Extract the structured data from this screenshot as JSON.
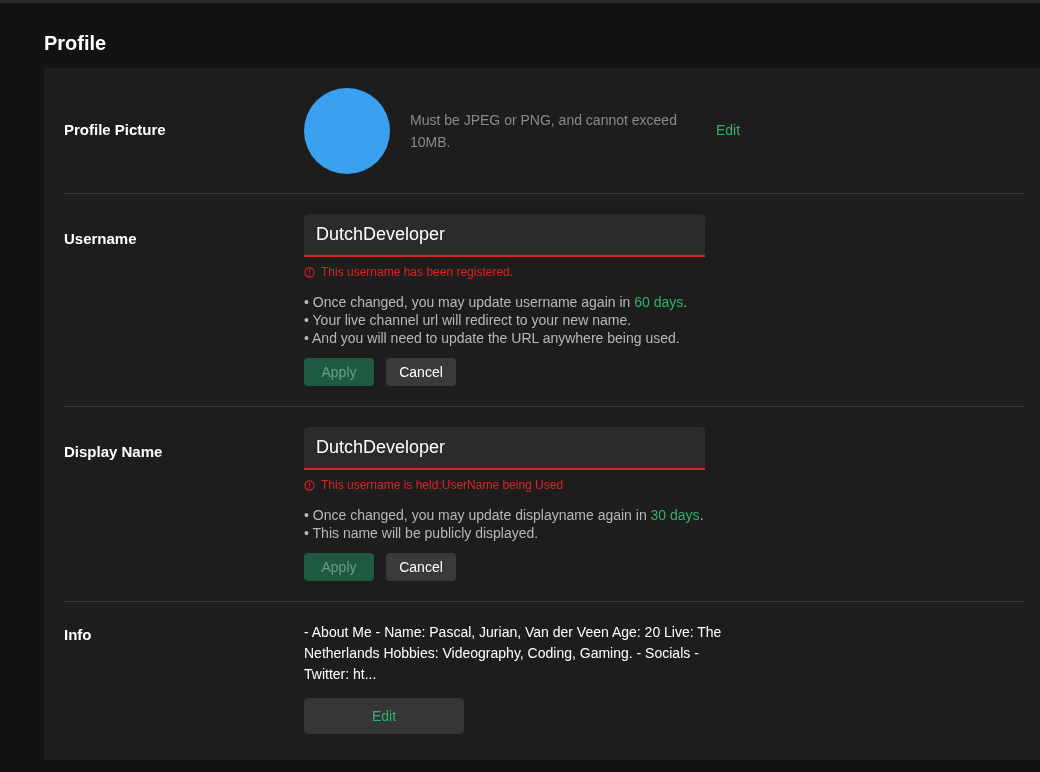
{
  "title": "Profile",
  "picture": {
    "label": "Profile Picture",
    "hint": "Must be JPEG or PNG, and cannot exceed 10MB.",
    "action": "Edit"
  },
  "fields": [
    {
      "label": "Username",
      "value": "DutchDeveloper",
      "error": "This username has been registered.",
      "notes": [
        [
          {
            "kind": "plain",
            "text": "• Once changed, you may update username again in "
          },
          {
            "kind": "accent",
            "text": "60 days"
          },
          {
            "kind": "plain",
            "text": "."
          }
        ],
        [
          {
            "kind": "plain",
            "text": "• Your live channel url will redirect to your new name."
          }
        ],
        [
          {
            "kind": "plain",
            "text": "• And you will need to update the URL anywhere being used."
          }
        ]
      ],
      "apply": {
        "label": "Apply",
        "disabled": true
      },
      "cancel": "Cancel"
    },
    {
      "label": "Display Name",
      "value": "DutchDeveloper",
      "error": "This username is held:UserName being Used",
      "notes": [
        [
          {
            "kind": "plain",
            "text": "• Once changed, you may update displayname again in "
          },
          {
            "kind": "accent",
            "text": "30 days"
          },
          {
            "kind": "plain",
            "text": "."
          }
        ],
        [
          {
            "kind": "plain",
            "text": "• This name will be publicly displayed."
          }
        ]
      ],
      "apply": {
        "label": "Apply",
        "disabled": true
      },
      "cancel": "Cancel"
    }
  ],
  "info": {
    "label": "Info",
    "text": "- About Me - Name: Pascal, Jurian, Van der Veen Age: 20 Live: The Netherlands Hobbies: Videography, Coding, Gaming. - Socials - Twitter: ht...",
    "action": "Edit"
  }
}
